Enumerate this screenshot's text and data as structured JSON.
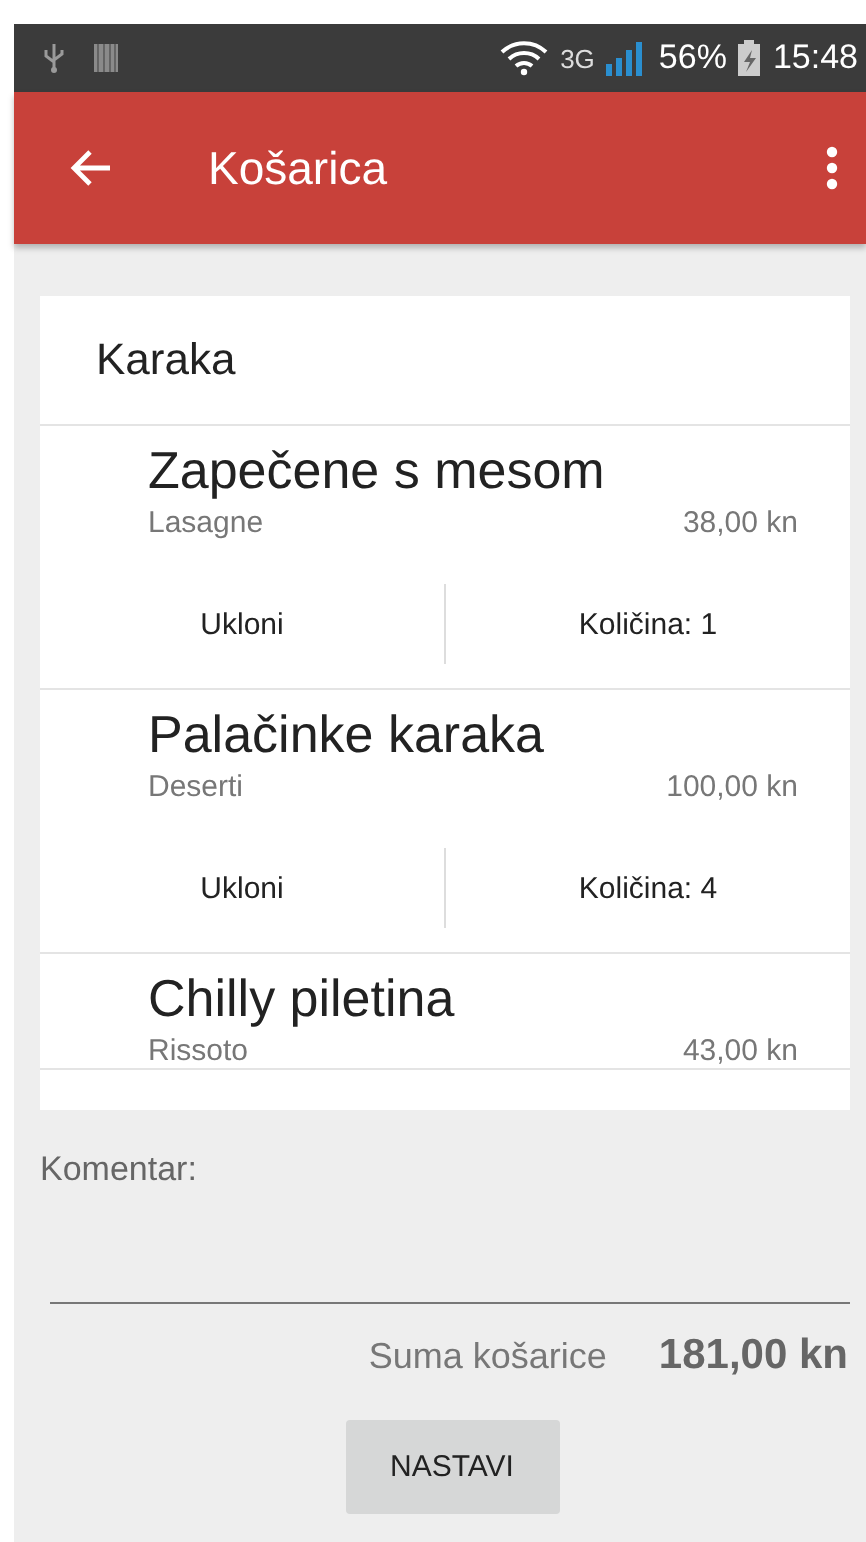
{
  "status_bar": {
    "network": "3G",
    "battery": "56%",
    "time": "15:48"
  },
  "app_bar": {
    "title": "Košarica"
  },
  "restaurant": {
    "name": "Karaka"
  },
  "items": [
    {
      "name": "Zapečene s mesom",
      "category": "Lasagne",
      "price": "38,00 kn",
      "actions": {
        "remove": "Ukloni",
        "quantity": "Količina: 1"
      }
    },
    {
      "name": "Palačinke karaka",
      "category": "Deserti",
      "price": "100,00 kn",
      "actions": {
        "remove": "Ukloni",
        "quantity": "Količina: 4"
      }
    },
    {
      "name": "Chilly piletina",
      "category": "Rissoto",
      "price": "43,00 kn"
    }
  ],
  "comment": {
    "label": "Komentar:"
  },
  "total": {
    "label": "Suma košarice",
    "value": "181,00 kn"
  },
  "buttons": [
    "NASTAVI"
  ]
}
